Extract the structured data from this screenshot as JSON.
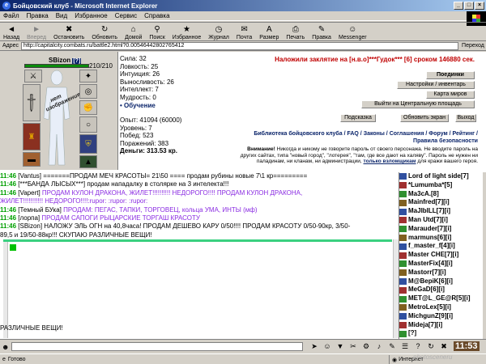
{
  "window": {
    "title": "Бойцовский клуб - Microsoft Internet Explorer",
    "minimize": "_",
    "maximize": "□",
    "close": "×"
  },
  "menu": [
    "Файл",
    "Правка",
    "Вид",
    "Избранное",
    "Сервис",
    "Справка"
  ],
  "toolbar": [
    {
      "label": "Назад",
      "icon": "back-arrow-icon",
      "glyph": "◄"
    },
    {
      "label": "Вперед",
      "icon": "forward-arrow-icon",
      "glyph": "►",
      "disabled": true
    },
    {
      "label": "Остановить",
      "icon": "stop-icon",
      "glyph": "✖"
    },
    {
      "label": "Обновить",
      "icon": "refresh-icon",
      "glyph": "↻"
    },
    {
      "label": "Домой",
      "icon": "home-icon",
      "glyph": "⌂"
    },
    {
      "label": "Поиск",
      "icon": "search-icon",
      "glyph": "⚲"
    },
    {
      "label": "Избранное",
      "icon": "favorites-icon",
      "glyph": "★"
    },
    {
      "label": "Журнал",
      "icon": "history-icon",
      "glyph": "◷"
    },
    {
      "label": "Почта",
      "icon": "mail-icon",
      "glyph": "✉"
    },
    {
      "label": "Размер",
      "icon": "font-size-icon",
      "glyph": "A"
    },
    {
      "label": "Печать",
      "icon": "print-icon",
      "glyph": "⎙"
    },
    {
      "label": "Правка",
      "icon": "edit-icon",
      "glyph": "✎"
    },
    {
      "label": "Messenger",
      "icon": "messenger-icon",
      "glyph": "☺"
    }
  ],
  "address": {
    "label": "Адрес",
    "url": "http://capitalcity.combats.ru/battle2.html?0.00546442802765412",
    "go": "Переход"
  },
  "character": {
    "name": "SBizon",
    "info_badge": "[?]",
    "hp": "210/210",
    "hp_fraction": 1.0,
    "no_image": "нет изображения"
  },
  "stats": {
    "strength": "Сила: 32",
    "agility": "Ловкость: 25",
    "intuition": "Интуиция: 26",
    "endurance": "Выносливость: 26",
    "intellect": "Интеллект: 7",
    "wisdom": "Мудрость: 0",
    "training": "• Обучение",
    "exp": "Опыт: 41094 (60000)",
    "level": "Уровень: 7",
    "wins": "Побед: 523",
    "losses": "Поражений: 383",
    "money": "Деньги: 313.53 кр."
  },
  "curse": "Наложили заклятие на [н.в.о]***Гудок*** [6] сроком 146880 сек.",
  "buttons": {
    "fights": "Поединки",
    "settings": "Настройки / инвентарь",
    "map": "Карта миров",
    "exit_square": "Выйти на Центральную площадь",
    "hint": "Подсказка",
    "refresh": "Обновить экран",
    "exit": "Выход"
  },
  "links": {
    "line1": "Библиотека бойцовского клуба / FAQ / Законы / Соглашения / Форум / Рейтинг /",
    "line2": "Правила безопасности"
  },
  "warning": {
    "bold": "Внимание!",
    "text": " Никогда и никому не говорите пароль от своего персонажа. Не вводите пароль на других сайтах, типа \"новый город\", \"лотерея\", \"там, где все дают на халяву\". Пароль не нужен ни паладинам, ни кланам, ни администрации, ",
    "link": "только взломщикам",
    "tail": " для кражи вашего героя."
  },
  "chat": [
    {
      "time": "11:46",
      "nick": "[Vantus]",
      "text": "=======ПРОДАМ МЕЧ КРАСОТЫ= 21\\50 ==== продам рубины новые 7\\1 кр=========",
      "kind": "n"
    },
    {
      "time": "11:46",
      "nick": "[***БАНДА ЛЫСЫХ***]",
      "text": "продам нападалку в столярке на 3 интелекта!!!",
      "kind": "n"
    },
    {
      "time": "11:46",
      "nick": "[Vapert]",
      "text": "ПРОДАМ КУЛОН ДРАКОНА, ЖИЛЕТ!!!!!!!!!! НЕДОРОГО!!!! ПРОДАМ КУЛОН ДРАКОНА,",
      "kind": "m"
    },
    {
      "time": "",
      "nick": "",
      "text": "ЖИЛЕТ!!!!!!!!!!! НЕДОРОГО!!!!:rupor: :rupor: :rupor:",
      "kind": "m"
    },
    {
      "time": "11:46",
      "nick": "[Темный БУка]",
      "text": "ПРОДАМ: ПЕГАС, ТАПКИ, ТОРГОВЕЦ, кольца УМА, ИНТЫ (мф)",
      "kind": "m"
    },
    {
      "time": "11:46",
      "nick": "[лорпа]",
      "text": "ПРОДАМ САПОГИ РЫЦАРСКИЕ ТОРГАШ КРАСОТУ",
      "kind": "m"
    },
    {
      "time": "11:46",
      "nick": "[SBizon]",
      "text": "НАЛОЖУ ЭЛЬ ОГН на 40,8часа! ПРОДАМ ДЕШЕВО КАРУ 0/50!!!! ПРОДАМ КРАСОТУ 0/50-90кр, 3/50-",
      "kind": "n"
    },
    {
      "time": "",
      "nick": "",
      "text": "89,5 и 19/50-88кр!!! СКУПАЮ РАЗЛИЧНЫЕ ВЕЩИ!",
      "kind": "n"
    }
  ],
  "editor_bottom": "РАЗЛИЧНЫЕ ВЕЩИ!",
  "players": [
    {
      "name": "Lord of light side[7]",
      "icon": "clan-icon"
    },
    {
      "name": "*Lumumba*[5]",
      "icon": "clan-icon"
    },
    {
      "name": "Ma3cA.[8]",
      "icon": "clan-icon"
    },
    {
      "name": "Mainfred[7][i]",
      "icon": "clan-icon"
    },
    {
      "name": "MaJIbILL[7][i]",
      "icon": "clan-icon"
    },
    {
      "name": "Man Utd[7][i]",
      "icon": "clan-icon"
    },
    {
      "name": "Marauder[7][i]",
      "icon": "clan-icon"
    },
    {
      "name": "marmuns[6][i]",
      "icon": "clan-icon"
    },
    {
      "name": "f_master_f[4][i]",
      "icon": "clan-icon"
    },
    {
      "name": "Master CHE[7][i]",
      "icon": "clan-icon"
    },
    {
      "name": "MasterFix[4][i]",
      "icon": "clan-icon"
    },
    {
      "name": "Mastorr[7][i]",
      "icon": "clan-icon"
    },
    {
      "name": "M@BepiK[6][i]",
      "icon": "clan-icon"
    },
    {
      "name": "MeGaD[6][i]",
      "icon": "clan-icon"
    },
    {
      "name": "MET@L_GE@R[5][i]",
      "icon": "clan-icon"
    },
    {
      "name": "MetroLex[5][i]",
      "icon": "clan-icon"
    },
    {
      "name": "MichgunZ[9][i]",
      "icon": "clan-icon"
    },
    {
      "name": "Mideja[7][i]",
      "icon": "clan-icon"
    },
    {
      "name": "[?]",
      "icon": "clan-icon"
    }
  ],
  "clock": "11:53",
  "status": {
    "left": "Готово",
    "zone": "Интернет"
  },
  "watermark": "photosceneru"
}
